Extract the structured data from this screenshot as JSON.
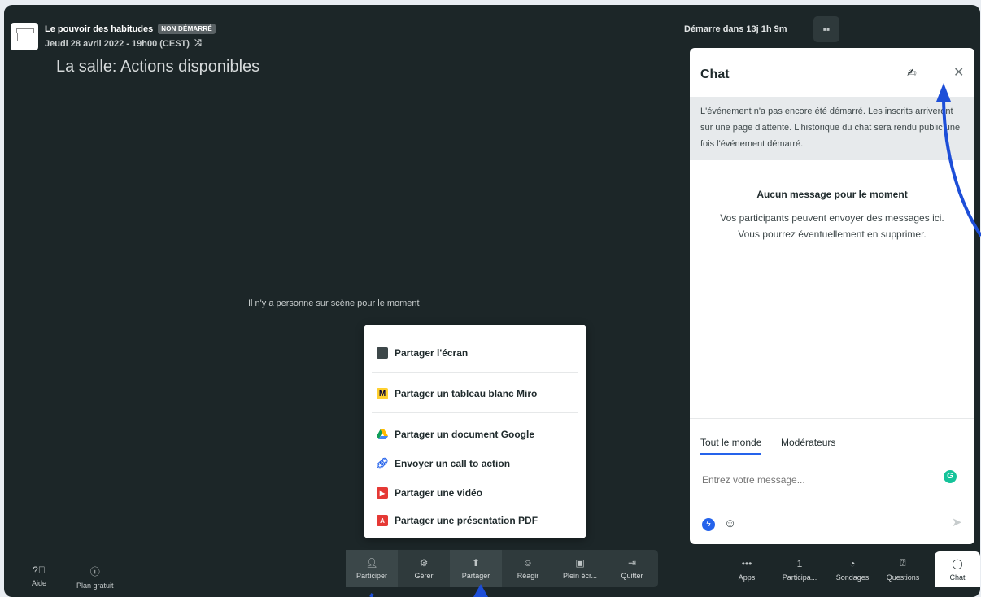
{
  "header": {
    "event_title": "Le pouvoir des habitudes",
    "status_badge": "NON DÉMARRÉ",
    "event_date": "Jeudi 28 avril 2022 - 19h00 (CEST)",
    "room_title": "La salle: Actions disponibles",
    "countdown": "Démarre dans 13j 1h 9m"
  },
  "stage": {
    "empty_text": "Il n'y a personne sur scène pour le moment"
  },
  "share_menu": {
    "items": [
      {
        "label": "Partager l'écran",
        "icon": "monitor-icon"
      },
      {
        "label": "Partager un tableau blanc Miro",
        "icon": "miro-icon"
      },
      {
        "label": "Partager un document Google",
        "icon": "google-drive-icon"
      },
      {
        "label": "Envoyer un call to action",
        "icon": "link-icon"
      },
      {
        "label": "Partager une vidéo",
        "icon": "youtube-icon"
      },
      {
        "label": "Partager une présentation PDF",
        "icon": "pdf-icon"
      }
    ]
  },
  "bottom_left": {
    "help": "Aide",
    "plan": "Plan gratuit"
  },
  "toolbar": {
    "items": [
      {
        "label": "Participer",
        "icon": "person-plus-icon"
      },
      {
        "label": "Gérer",
        "icon": "gear-icon"
      },
      {
        "label": "Partager",
        "icon": "share-icon"
      },
      {
        "label": "Réagir",
        "icon": "smiley-icon"
      },
      {
        "label": "Plein écr...",
        "icon": "fullscreen-icon"
      },
      {
        "label": "Quitter",
        "icon": "exit-icon"
      }
    ]
  },
  "chat": {
    "title": "Chat",
    "notice": "L'événement n'a pas encore été démarré. Les inscrits arriveront sur une page d'attente. L'historique du chat sera rendu public une fois l'événement démarré.",
    "empty_title": "Aucun message pour le moment",
    "empty_line1": "Vos participants peuvent envoyer des messages ici.",
    "empty_line2": "Vous pourrez éventuellement en supprimer.",
    "tab_all": "Tout le monde",
    "tab_mods": "Modérateurs",
    "input_placeholder": "Entrez votre message..."
  },
  "right_tabs": {
    "items": [
      {
        "label": "Apps",
        "icon": "dots-icon",
        "value": "•••"
      },
      {
        "label": "Participa...",
        "icon": "count",
        "value": "1"
      },
      {
        "label": "Sondages",
        "icon": "poll-icon",
        "value": ""
      },
      {
        "label": "Questions",
        "icon": "question-icon",
        "value": ""
      },
      {
        "label": "Chat",
        "icon": "chat-icon",
        "value": ""
      }
    ]
  },
  "colors": {
    "background": "#1c2628",
    "accent": "#2563eb",
    "annotation_arrow": "#1d4ed8"
  }
}
